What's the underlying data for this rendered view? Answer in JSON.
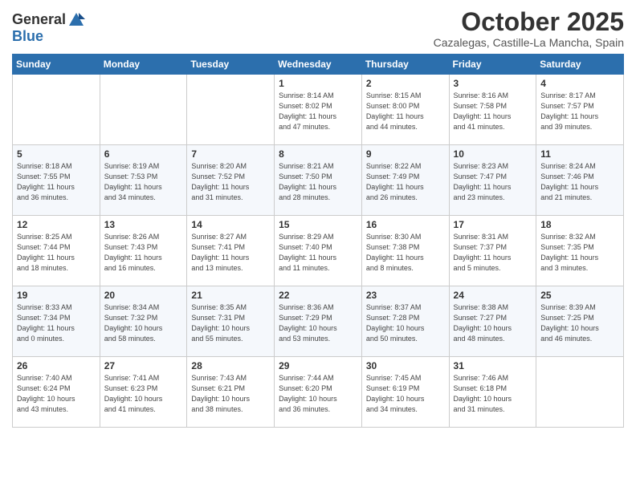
{
  "header": {
    "logo_general": "General",
    "logo_blue": "Blue",
    "month": "October 2025",
    "location": "Cazalegas, Castille-La Mancha, Spain"
  },
  "days_of_week": [
    "Sunday",
    "Monday",
    "Tuesday",
    "Wednesday",
    "Thursday",
    "Friday",
    "Saturday"
  ],
  "weeks": [
    [
      {
        "day": "",
        "info": ""
      },
      {
        "day": "",
        "info": ""
      },
      {
        "day": "",
        "info": ""
      },
      {
        "day": "1",
        "info": "Sunrise: 8:14 AM\nSunset: 8:02 PM\nDaylight: 11 hours\nand 47 minutes."
      },
      {
        "day": "2",
        "info": "Sunrise: 8:15 AM\nSunset: 8:00 PM\nDaylight: 11 hours\nand 44 minutes."
      },
      {
        "day": "3",
        "info": "Sunrise: 8:16 AM\nSunset: 7:58 PM\nDaylight: 11 hours\nand 41 minutes."
      },
      {
        "day": "4",
        "info": "Sunrise: 8:17 AM\nSunset: 7:57 PM\nDaylight: 11 hours\nand 39 minutes."
      }
    ],
    [
      {
        "day": "5",
        "info": "Sunrise: 8:18 AM\nSunset: 7:55 PM\nDaylight: 11 hours\nand 36 minutes."
      },
      {
        "day": "6",
        "info": "Sunrise: 8:19 AM\nSunset: 7:53 PM\nDaylight: 11 hours\nand 34 minutes."
      },
      {
        "day": "7",
        "info": "Sunrise: 8:20 AM\nSunset: 7:52 PM\nDaylight: 11 hours\nand 31 minutes."
      },
      {
        "day": "8",
        "info": "Sunrise: 8:21 AM\nSunset: 7:50 PM\nDaylight: 11 hours\nand 28 minutes."
      },
      {
        "day": "9",
        "info": "Sunrise: 8:22 AM\nSunset: 7:49 PM\nDaylight: 11 hours\nand 26 minutes."
      },
      {
        "day": "10",
        "info": "Sunrise: 8:23 AM\nSunset: 7:47 PM\nDaylight: 11 hours\nand 23 minutes."
      },
      {
        "day": "11",
        "info": "Sunrise: 8:24 AM\nSunset: 7:46 PM\nDaylight: 11 hours\nand 21 minutes."
      }
    ],
    [
      {
        "day": "12",
        "info": "Sunrise: 8:25 AM\nSunset: 7:44 PM\nDaylight: 11 hours\nand 18 minutes."
      },
      {
        "day": "13",
        "info": "Sunrise: 8:26 AM\nSunset: 7:43 PM\nDaylight: 11 hours\nand 16 minutes."
      },
      {
        "day": "14",
        "info": "Sunrise: 8:27 AM\nSunset: 7:41 PM\nDaylight: 11 hours\nand 13 minutes."
      },
      {
        "day": "15",
        "info": "Sunrise: 8:29 AM\nSunset: 7:40 PM\nDaylight: 11 hours\nand 11 minutes."
      },
      {
        "day": "16",
        "info": "Sunrise: 8:30 AM\nSunset: 7:38 PM\nDaylight: 11 hours\nand 8 minutes."
      },
      {
        "day": "17",
        "info": "Sunrise: 8:31 AM\nSunset: 7:37 PM\nDaylight: 11 hours\nand 5 minutes."
      },
      {
        "day": "18",
        "info": "Sunrise: 8:32 AM\nSunset: 7:35 PM\nDaylight: 11 hours\nand 3 minutes."
      }
    ],
    [
      {
        "day": "19",
        "info": "Sunrise: 8:33 AM\nSunset: 7:34 PM\nDaylight: 11 hours\nand 0 minutes."
      },
      {
        "day": "20",
        "info": "Sunrise: 8:34 AM\nSunset: 7:32 PM\nDaylight: 10 hours\nand 58 minutes."
      },
      {
        "day": "21",
        "info": "Sunrise: 8:35 AM\nSunset: 7:31 PM\nDaylight: 10 hours\nand 55 minutes."
      },
      {
        "day": "22",
        "info": "Sunrise: 8:36 AM\nSunset: 7:29 PM\nDaylight: 10 hours\nand 53 minutes."
      },
      {
        "day": "23",
        "info": "Sunrise: 8:37 AM\nSunset: 7:28 PM\nDaylight: 10 hours\nand 50 minutes."
      },
      {
        "day": "24",
        "info": "Sunrise: 8:38 AM\nSunset: 7:27 PM\nDaylight: 10 hours\nand 48 minutes."
      },
      {
        "day": "25",
        "info": "Sunrise: 8:39 AM\nSunset: 7:25 PM\nDaylight: 10 hours\nand 46 minutes."
      }
    ],
    [
      {
        "day": "26",
        "info": "Sunrise: 7:40 AM\nSunset: 6:24 PM\nDaylight: 10 hours\nand 43 minutes."
      },
      {
        "day": "27",
        "info": "Sunrise: 7:41 AM\nSunset: 6:23 PM\nDaylight: 10 hours\nand 41 minutes."
      },
      {
        "day": "28",
        "info": "Sunrise: 7:43 AM\nSunset: 6:21 PM\nDaylight: 10 hours\nand 38 minutes."
      },
      {
        "day": "29",
        "info": "Sunrise: 7:44 AM\nSunset: 6:20 PM\nDaylight: 10 hours\nand 36 minutes."
      },
      {
        "day": "30",
        "info": "Sunrise: 7:45 AM\nSunset: 6:19 PM\nDaylight: 10 hours\nand 34 minutes."
      },
      {
        "day": "31",
        "info": "Sunrise: 7:46 AM\nSunset: 6:18 PM\nDaylight: 10 hours\nand 31 minutes."
      },
      {
        "day": "",
        "info": ""
      }
    ]
  ]
}
